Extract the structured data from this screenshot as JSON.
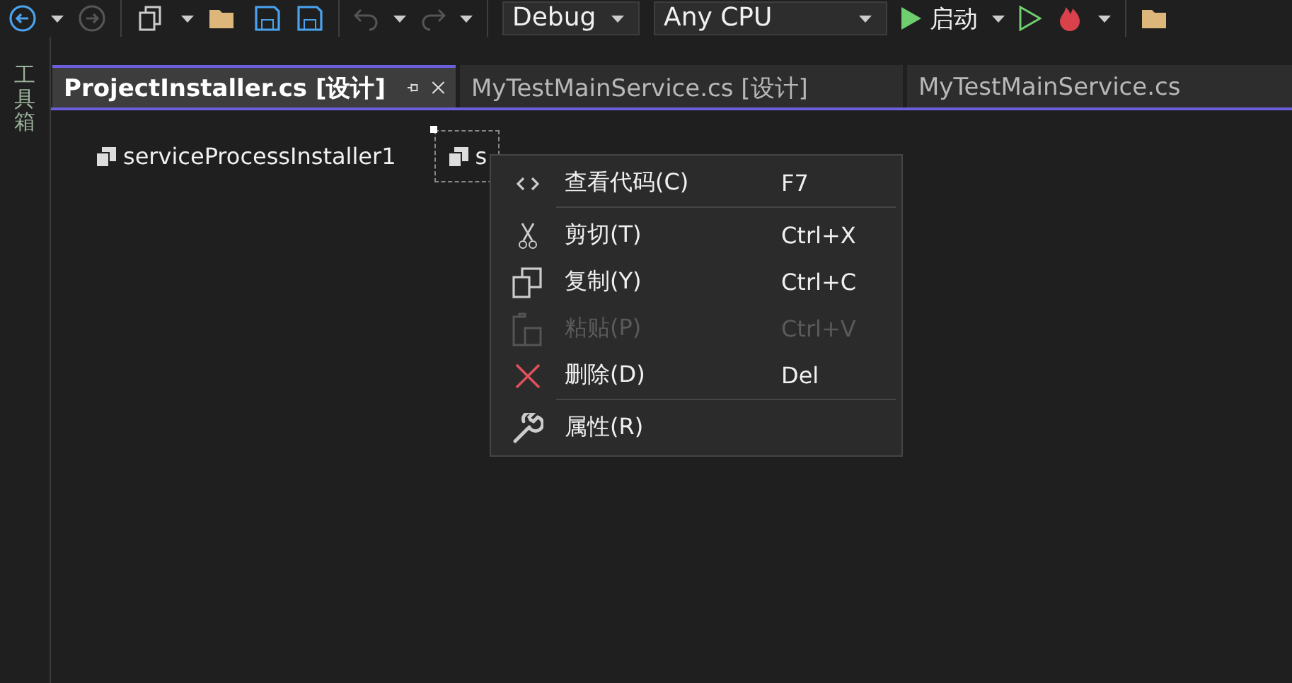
{
  "toolbar": {
    "configuration": "Debug",
    "platform": "Any CPU",
    "start_label": "启动"
  },
  "toolbox": {
    "label": "工具箱"
  },
  "tabs": [
    {
      "label": "ProjectInstaller.cs [设计]",
      "selected": true
    },
    {
      "label": "MyTestMainService.cs [设计]",
      "selected": false
    },
    {
      "label": "MyTestMainService.cs",
      "selected": false
    }
  ],
  "components": [
    {
      "label": "serviceProcessInstaller1",
      "selected": false
    },
    {
      "label": "s",
      "selected": true
    }
  ],
  "context_menu": {
    "items": [
      {
        "kind": "code",
        "label": "查看代码(C)",
        "shortcut": "F7",
        "disabled": false,
        "separator_after": true
      },
      {
        "kind": "cut",
        "label": "剪切(T)",
        "shortcut": "Ctrl+X",
        "disabled": false,
        "separator_after": false
      },
      {
        "kind": "copy",
        "label": "复制(Y)",
        "shortcut": "Ctrl+C",
        "disabled": false,
        "separator_after": false
      },
      {
        "kind": "paste",
        "label": "粘贴(P)",
        "shortcut": "Ctrl+V",
        "disabled": true,
        "separator_after": false
      },
      {
        "kind": "delete",
        "label": "删除(D)",
        "shortcut": "Del",
        "disabled": false,
        "separator_after": true
      },
      {
        "kind": "properties",
        "label": "属性(R)",
        "disabled": false,
        "separator_after": false
      }
    ]
  }
}
